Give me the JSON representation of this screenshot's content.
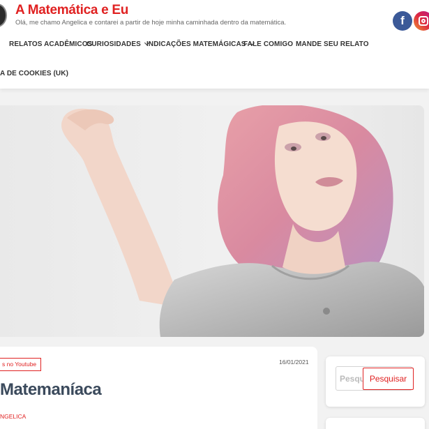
{
  "header": {
    "site_title": "A Matemática e Eu",
    "tagline": "Olá, me chamo Angelica e contarei a partir de hoje minha caminhada dentro da matemática.",
    "social": [
      {
        "icon": "facebook-icon",
        "glyph": "f",
        "color": "#3b5998"
      },
      {
        "icon": "instagram-icon",
        "color": "#dc2743"
      }
    ]
  },
  "nav": {
    "items": [
      {
        "label": "RELATOS ACADÊMICOS",
        "has_dropdown": false
      },
      {
        "label": "CURIOSIDADES",
        "has_dropdown": true
      },
      {
        "label": "INDICAÇÕES MATEMÁGICAS",
        "has_dropdown": true
      },
      {
        "label": "FALE COMIGO",
        "has_dropdown": false
      },
      {
        "label": "MANDE SEU RELATO",
        "has_dropdown": false
      },
      {
        "label": "A DE COOKIES (UK)",
        "has_dropdown": false
      }
    ]
  },
  "post": {
    "category": "s no Youtube",
    "date": "16/01/2021",
    "title": "Matemaníaca",
    "author": "NGELICA"
  },
  "sidebar": {
    "search_placeholder": "Pesquisar",
    "search_button": "Pesquisar"
  },
  "colors": {
    "accent": "#e02121",
    "title_text": "#3b4a5c",
    "background": "#f2f2f2"
  }
}
